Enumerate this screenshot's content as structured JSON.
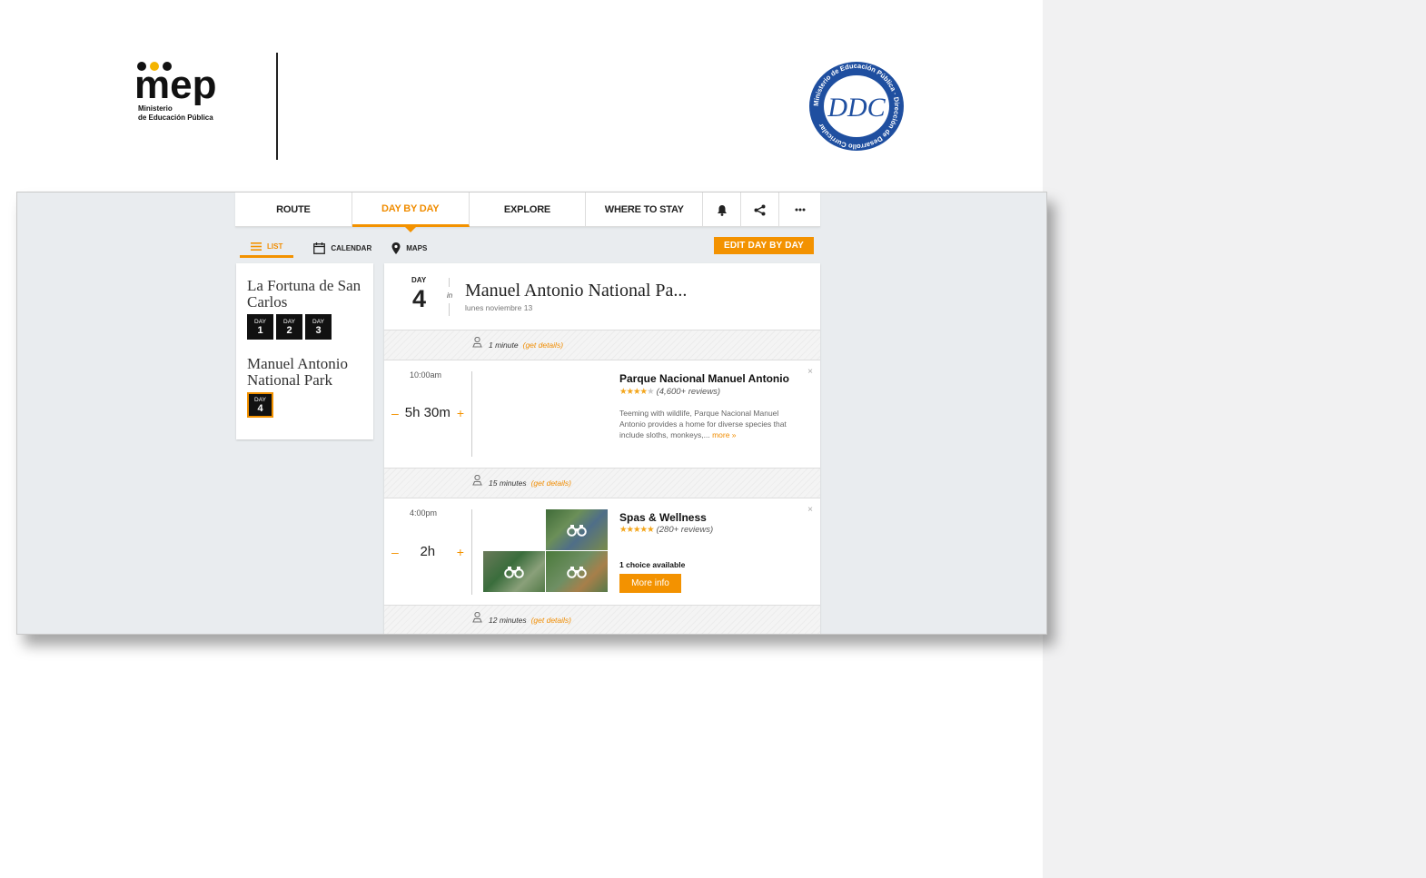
{
  "header": {
    "mep_logo_text": "mep",
    "mep_subtitle_line1": "Ministerio",
    "mep_subtitle_line2": "de Educación Pública",
    "seal_ring_text": "Ministerio de Educación Pública · Dirección de Desarrollo Curricular",
    "seal_monogram": "DDC"
  },
  "tabs": [
    {
      "label": "ROUTE",
      "active": false
    },
    {
      "label": "DAY BY DAY",
      "active": true
    },
    {
      "label": "EXPLORE",
      "active": false
    },
    {
      "label": "WHERE TO STAY",
      "active": false
    }
  ],
  "tab_icons": [
    "bell-icon",
    "share-icon",
    "more-icon"
  ],
  "subnav": {
    "list": "LIST",
    "calendar": "CALENDAR",
    "maps": "MAPS",
    "edit_button": "EDIT DAY BY DAY"
  },
  "destinations": [
    {
      "name": "La Fortuna de San Carlos",
      "days": [
        {
          "label": "DAY",
          "num": "1"
        },
        {
          "label": "DAY",
          "num": "2"
        },
        {
          "label": "DAY",
          "num": "3"
        }
      ]
    },
    {
      "name": "Manuel Antonio National Park",
      "days": [
        {
          "label": "DAY",
          "num": "4"
        }
      ]
    }
  ],
  "day_header": {
    "label": "DAY",
    "number": "4",
    "in": "in",
    "title": "Manuel Antonio National Pa...",
    "date": "lunes noviembre 13"
  },
  "travel": [
    {
      "time": "1 minute",
      "details": "(get details)"
    },
    {
      "time": "15 minutes",
      "details": "(get details)"
    },
    {
      "time": "12 minutes",
      "details": "(get details)"
    }
  ],
  "activities": [
    {
      "time": "10:00am",
      "duration": "5h 30m",
      "name": "Parque Nacional Manuel Antonio",
      "rating": 4,
      "reviews": "(4,600+ reviews)",
      "description": "Teeming with wildlife, Parque Nacional Manuel Antonio provides a home for diverse species that include sloths, monkeys,...",
      "more": "more »"
    },
    {
      "time": "4:00pm",
      "duration": "2h",
      "name": "Spas & Wellness",
      "rating": 5,
      "reviews": "(280+ reviews)",
      "choice": "1 choice available",
      "button": "More info"
    }
  ],
  "symbols": {
    "minus": "–",
    "plus": "+",
    "close": "×",
    "stars_on": "★★★★",
    "star_off": "★",
    "stars_five": "★★★★★"
  },
  "colors": {
    "accent": "#f39200",
    "frame_bg": "#e9ecef",
    "right_panel": "#f1f1f2",
    "seal_blue": "#1f4fa0"
  }
}
